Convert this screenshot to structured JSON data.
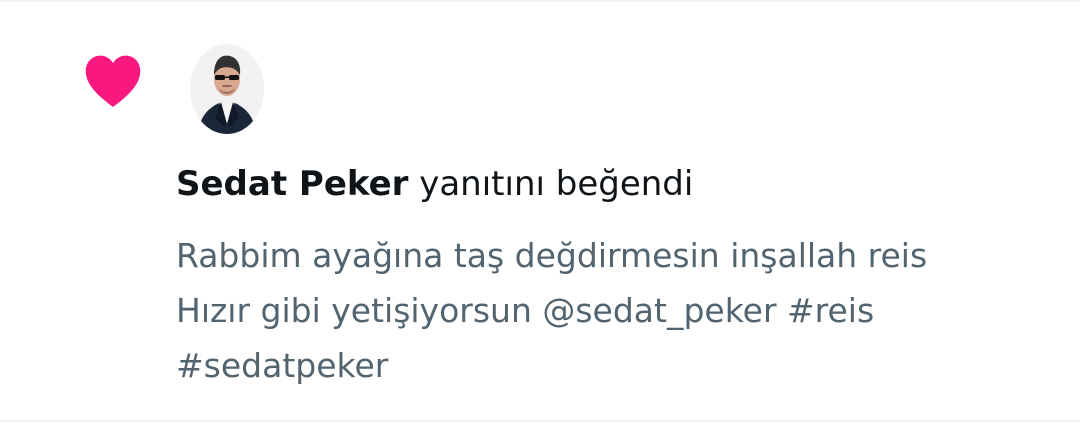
{
  "notification": {
    "type_icon": "heart-icon",
    "actor": {
      "name": "Sedat Peker",
      "avatar": "avatar-photo"
    },
    "action_text": " yanıtını beğendi",
    "reply_text": "Rabbim ayağına taş değdirmesin inşallah reis\nHızır gibi yetişiyorsun @sedat_peker #reis\n#sedatpeker"
  },
  "colors": {
    "heart": "#f91880",
    "primary_text": "#0f1419",
    "secondary_text": "#536471",
    "divider": "#eff3f4"
  }
}
